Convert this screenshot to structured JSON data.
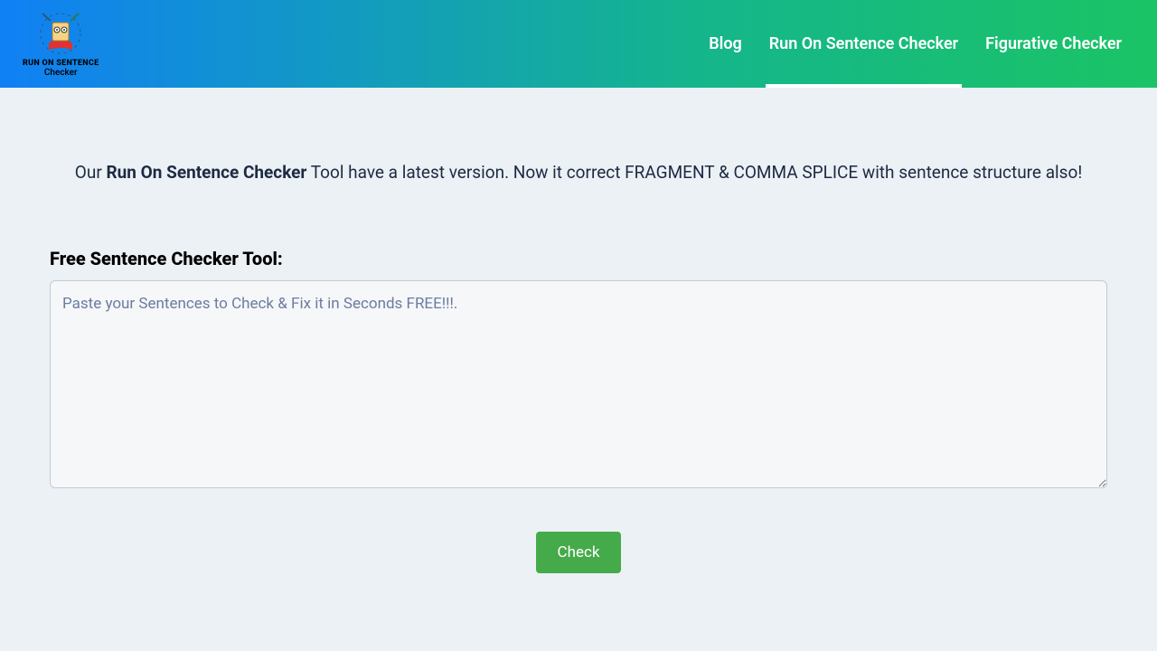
{
  "logo": {
    "line1": "RUN ON SENTENCE",
    "line2": "Checker"
  },
  "nav": {
    "blog": "Blog",
    "runon": "Run On Sentence Checker",
    "figurative": "Figurative Checker"
  },
  "intro": {
    "pre": "Our ",
    "bold": "Run On Sentence Checker",
    "post": " Tool have a latest version. Now it correct FRAGMENT & COMMA SPLICE with sentence structure also!"
  },
  "tool": {
    "title": "Free Sentence Checker Tool:",
    "placeholder": "Paste your Sentences to Check & Fix it in Seconds FREE!!!.",
    "button": "Check"
  }
}
